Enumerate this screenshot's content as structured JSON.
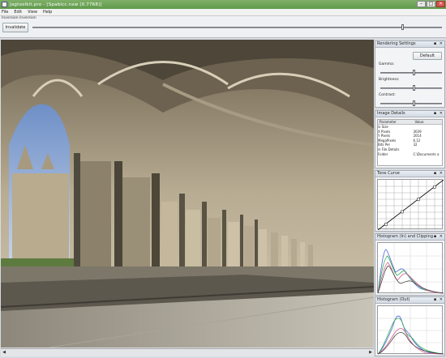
{
  "window": {
    "title": "Jagtoolkit.pro - [Spabicc.nxw (0.7768)]"
  },
  "menu": [
    "File",
    "Edit",
    "View",
    "Help"
  ],
  "tool_window": {
    "label": "Inversion Inversion",
    "invert_button": "Invalidate",
    "slider_value": 0.9
  },
  "rendering": {
    "title": "Rendering Settings",
    "default_button": "Default",
    "gamma_label": "Gamma:",
    "brightness_label": "Brightness:",
    "contrast_label": "Contrast:",
    "gamma_value": 0.55,
    "brightness_value": 0.55,
    "contrast_value": 0.55
  },
  "image_details": {
    "title": "Image Details",
    "col_param": "Parameter",
    "col_value": "Value",
    "rows": [
      {
        "k": "⊟ Size",
        "v": ""
      },
      {
        "k": "   X Pixels",
        "v": "3039"
      },
      {
        "k": "   Y Pixels",
        "v": "2014"
      },
      {
        "k": "   MegaPixels",
        "v": "6.12"
      },
      {
        "k": "   Bits Per",
        "v": "32"
      },
      {
        "k": "⊟ File Details",
        "v": ""
      },
      {
        "k": "   Folder",
        "v": "C:\\Documents a"
      }
    ]
  },
  "tone_curve": {
    "title": "Tone Curve"
  },
  "histogram_raw": {
    "title": "Histogram (In) and Clipping"
  },
  "histogram_out": {
    "title": "Histogram (Out)"
  }
}
